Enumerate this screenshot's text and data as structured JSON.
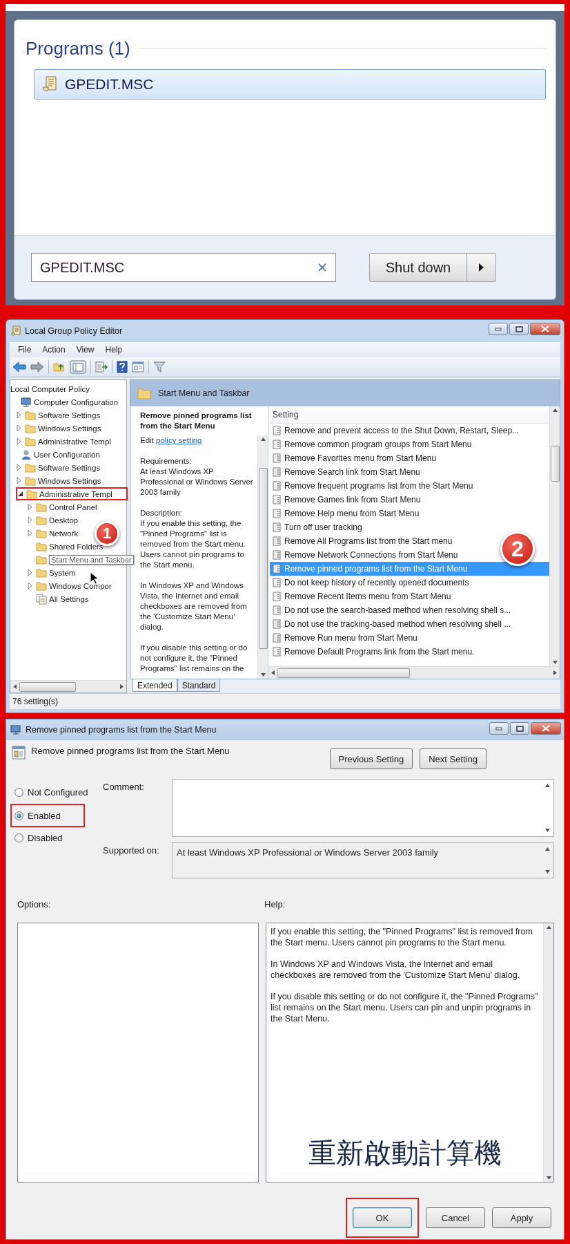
{
  "search_panel": {
    "section_title": "Programs (1)",
    "results": [
      {
        "label": "GPEDIT.MSC",
        "selected": true
      }
    ],
    "search_box": {
      "value": "GPEDIT.MSC"
    },
    "shutdown_button": {
      "label": "Shut down"
    }
  },
  "editor_window": {
    "title": "Local Group Policy Editor",
    "menu": [
      "File",
      "Action",
      "View",
      "Help"
    ],
    "tree": [
      {
        "label": "Local Computer Policy",
        "selected": false,
        "highlighted": false,
        "children": [
          {
            "label": "Computer Configuration",
            "kind": "computer",
            "selected": false,
            "highlighted": false,
            "children": [
              {
                "label": "Software Settings",
                "kind": "folder",
                "expanded": false,
                "selected": false,
                "highlighted": false
              },
              {
                "label": "Windows Settings",
                "kind": "folder",
                "expanded": false,
                "selected": false,
                "highlighted": false
              },
              {
                "label": "Administrative Templ",
                "kind": "folder",
                "expanded": false,
                "selected": false,
                "highlighted": false
              }
            ]
          },
          {
            "label": "User Configuration",
            "kind": "user",
            "selected": false,
            "highlighted": false,
            "children": [
              {
                "label": "Software Settings",
                "kind": "folder",
                "expanded": false,
                "selected": false,
                "highlighted": false
              },
              {
                "label": "Windows Settings",
                "kind": "folder",
                "expanded": false,
                "selected": false,
                "highlighted": false
              },
              {
                "label": "Administrative Templ",
                "kind": "folder",
                "expanded": true,
                "selected": false,
                "highlighted": true,
                "children": [
                  {
                    "label": "Control Panel",
                    "kind": "folder",
                    "expanded": false,
                    "selected": false,
                    "highlighted": false
                  },
                  {
                    "label": "Desktop",
                    "kind": "folder",
                    "expanded": false,
                    "selected": false,
                    "highlighted": false
                  },
                  {
                    "label": "Network",
                    "kind": "folder",
                    "expanded": false,
                    "selected": false,
                    "highlighted": false
                  },
                  {
                    "label": "Shared Folders",
                    "kind": "folder",
                    "selected": false,
                    "highlighted": false
                  },
                  {
                    "label": "Start Menu and Taskbar",
                    "kind": "folder",
                    "selected": true,
                    "highlighted": false
                  },
                  {
                    "label": "System",
                    "kind": "folder",
                    "expanded": false,
                    "selected": false,
                    "highlighted": false
                  },
                  {
                    "label": "Windows Compor",
                    "kind": "folder",
                    "expanded": false,
                    "selected": false,
                    "highlighted": false
                  },
                  {
                    "label": "All Settings",
                    "kind": "settings",
                    "selected": false,
                    "highlighted": false
                  }
                ]
              }
            ]
          }
        ]
      }
    ],
    "folder_title": "Start Menu and Taskbar",
    "description": {
      "title": "Remove pinned programs list from the Start Menu",
      "edit_prefix": "Edit",
      "edit_link": "policy setting",
      "requirements_label": "Requirements:",
      "requirements": "At least Windows XP Professional or Windows Server 2003 family",
      "description_label": "Description:",
      "paragraphs": [
        "If you enable this setting, the \"Pinned Programs\" list is removed from the Start menu. Users cannot pin programs to the Start menu.",
        "In Windows XP and Windows Vista, the Internet and email checkboxes are removed from the 'Customize Start Menu' dialog.",
        "If you disable this setting or do not configure it, the \"Pinned Programs\" list remains on the"
      ]
    },
    "settings_column": "Setting",
    "settings": [
      {
        "label": "Remove and prevent access to the Shut Down, Restart, Sleep...",
        "selected": false
      },
      {
        "label": "Remove common program groups from Start Menu",
        "selected": false
      },
      {
        "label": "Remove Favorites menu from Start Menu",
        "selected": false
      },
      {
        "label": "Remove Search link from Start Menu",
        "selected": false
      },
      {
        "label": "Remove frequent programs list from the Start Menu",
        "selected": false
      },
      {
        "label": "Remove Games link from Start Menu",
        "selected": false
      },
      {
        "label": "Remove Help menu from Start Menu",
        "selected": false
      },
      {
        "label": "Turn off user tracking",
        "selected": false
      },
      {
        "label": "Remove All Programs list from the Start menu",
        "selected": false
      },
      {
        "label": "Remove Network Connections from Start Menu",
        "selected": false
      },
      {
        "label": "Remove pinned programs list from the Start Menu",
        "selected": true
      },
      {
        "label": "Do not keep history of recently opened documents",
        "selected": false
      },
      {
        "label": "Remove Recent Items menu from Start Menu",
        "selected": false
      },
      {
        "label": "Do not use the search-based method when resolving shell s...",
        "selected": false
      },
      {
        "label": "Do not use the tracking-based method when resolving shell ...",
        "selected": false
      },
      {
        "label": "Remove Run menu from Start Menu",
        "selected": false
      },
      {
        "label": "Remove Default Programs link from the Start menu.",
        "selected": false
      }
    ],
    "tabs": [
      {
        "label": "Extended",
        "selected": true
      },
      {
        "label": "Standard",
        "selected": false
      }
    ],
    "status_bar": "76 setting(s)",
    "callouts": [
      {
        "label": "1"
      },
      {
        "label": "2"
      }
    ]
  },
  "policy_dialog": {
    "title": "Remove pinned programs list from the Start Menu",
    "policy_name": "Remove pinned programs list from the Start Menu",
    "nav_buttons": [
      "Previous Setting",
      "Next Setting"
    ],
    "states": [
      {
        "label": "Not Configured",
        "selected": false,
        "highlighted": false
      },
      {
        "label": "Enabled",
        "selected": true,
        "highlighted": true
      },
      {
        "label": "Disabled",
        "selected": false,
        "highlighted": false
      }
    ],
    "comment_label": "Comment:",
    "supported_label": "Supported on:",
    "supported_value": "At least Windows XP Professional or Windows Server 2003 family",
    "options_label": "Options:",
    "help_label": "Help:",
    "help_paragraphs": [
      "If you enable this setting, the \"Pinned Programs\" list is removed from the Start menu. Users cannot pin programs to the Start menu.",
      "In Windows XP and Windows Vista, the Internet and email checkboxes are removed from the 'Customize Start Menu' dialog.",
      "If you disable this setting or do not configure it, the \"Pinned Programs\" list remains on the Start menu. Users can pin and unpin programs in the Start Menu."
    ],
    "overlay_caption": "重新啟動計算機",
    "buttons": [
      {
        "label": "OK",
        "highlighted": true
      },
      {
        "label": "Cancel",
        "highlighted": false
      },
      {
        "label": "Apply",
        "highlighted": false
      }
    ]
  }
}
